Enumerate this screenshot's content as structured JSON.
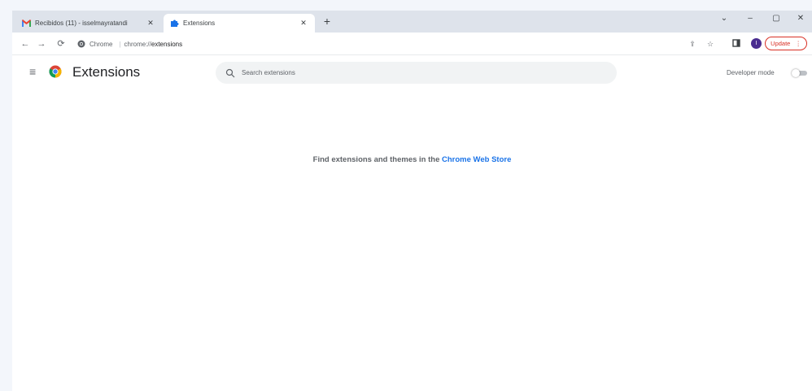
{
  "tabs": [
    {
      "title": "Recibidos (11) - isselmayratandi",
      "favicon": "gmail-icon",
      "active": false
    },
    {
      "title": "Extensions",
      "favicon": "puzzle-icon",
      "active": true
    }
  ],
  "window_controls": {
    "minimize": "–",
    "maximize": "▢",
    "close": "✕",
    "menu": "⌄"
  },
  "omnibox": {
    "site_label": "Chrome",
    "url_scheme": "chrome://",
    "url_path": "extensions"
  },
  "toolbar": {
    "profile_initial": "I",
    "update_label": "Update"
  },
  "extensions_page": {
    "title": "Extensions",
    "search_placeholder": "Search extensions",
    "developer_mode_label": "Developer mode",
    "developer_mode_on": false,
    "empty_message_lead": "Find extensions and themes in the",
    "empty_message_link": "Chrome Web Store"
  },
  "colors": {
    "accent": "#1a73e8",
    "update": "#d93025",
    "avatar": "#4a2c8f",
    "tabstrip": "#dee3eb"
  }
}
